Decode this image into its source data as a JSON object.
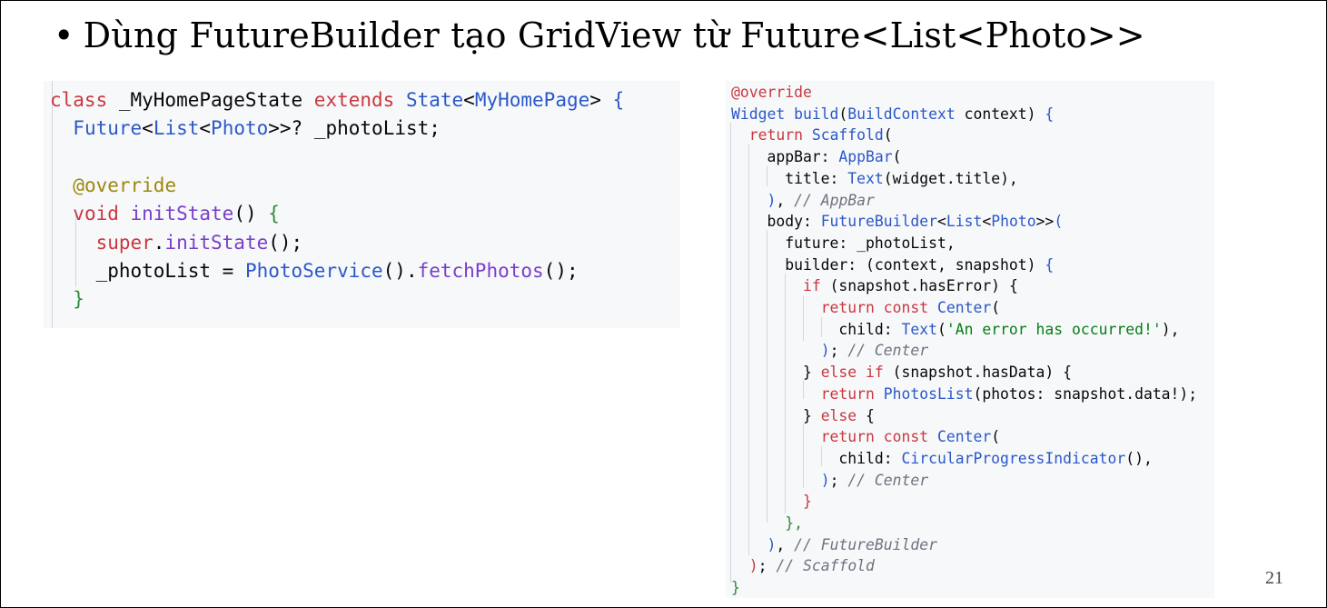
{
  "slide": {
    "bullet": "•",
    "title": "Dùng FutureBuilder tạo GridView từ Future<List<Photo>>",
    "page_number": "21"
  },
  "code_left": [
    [
      [
        "kw",
        "class "
      ],
      [
        "",
        "_MyHomePageState "
      ],
      [
        "kw",
        "extends "
      ],
      [
        "ty",
        "State"
      ],
      [
        "",
        "<"
      ],
      [
        "ty",
        "MyHomePage"
      ],
      [
        "",
        "> "
      ],
      [
        "pb",
        "{"
      ]
    ],
    [
      [
        "",
        "  "
      ],
      [
        "ty",
        "Future"
      ],
      [
        "",
        "<"
      ],
      [
        "ty",
        "List"
      ],
      [
        "",
        "<"
      ],
      [
        "ty",
        "Photo"
      ],
      [
        "",
        ">>? _photoList;"
      ]
    ],
    [],
    [
      [
        "",
        "  "
      ],
      [
        "an",
        "@override"
      ]
    ],
    [
      [
        "",
        "  "
      ],
      [
        "kw",
        "void "
      ],
      [
        "fn",
        "initState"
      ],
      [
        "",
        "() "
      ],
      [
        "pg",
        "{"
      ]
    ],
    [
      [
        "",
        "    "
      ],
      [
        "kw",
        "super"
      ],
      [
        "",
        "."
      ],
      [
        "fn",
        "initState"
      ],
      [
        "",
        "();"
      ]
    ],
    [
      [
        "",
        "    _photoList = "
      ],
      [
        "ty",
        "PhotoService"
      ],
      [
        "",
        "()."
      ],
      [
        "fn",
        "fetchPhotos"
      ],
      [
        "",
        "();"
      ]
    ],
    [
      [
        "",
        "  "
      ],
      [
        "pg",
        "}"
      ]
    ]
  ],
  "code_right": [
    [
      [
        "kw",
        "@override"
      ]
    ],
    [
      [
        "ty",
        "Widget "
      ],
      [
        "ty",
        "build"
      ],
      [
        "",
        "("
      ],
      [
        "ty",
        "BuildContext"
      ],
      [
        "",
        " context) "
      ],
      [
        "pb",
        "{"
      ]
    ],
    [
      [
        "",
        "  "
      ],
      [
        "kw",
        "return "
      ],
      [
        "ty",
        "Scaffold"
      ],
      [
        "",
        "("
      ]
    ],
    [
      [
        "",
        "    appBar: "
      ],
      [
        "ty",
        "AppBar"
      ],
      [
        "",
        "("
      ]
    ],
    [
      [
        "",
        "      title: "
      ],
      [
        "ty",
        "Text"
      ],
      [
        "",
        "(widget.title),"
      ]
    ],
    [
      [
        "",
        "    "
      ],
      [
        "pb",
        ")"
      ],
      [
        "",
        ", "
      ],
      [
        "cm",
        "// AppBar"
      ]
    ],
    [
      [
        "",
        "    body: "
      ],
      [
        "ty",
        "FutureBuilder"
      ],
      [
        "",
        "<"
      ],
      [
        "ty",
        "List"
      ],
      [
        "",
        "<"
      ],
      [
        "ty",
        "Photo"
      ],
      [
        "",
        ">>"
      ],
      [
        "pb",
        "("
      ]
    ],
    [
      [
        "",
        "      future: _photoList,"
      ]
    ],
    [
      [
        "",
        "      builder: (context, snapshot) "
      ],
      [
        "pb",
        "{"
      ]
    ],
    [
      [
        "",
        "        "
      ],
      [
        "kw",
        "if "
      ],
      [
        "",
        "(snapshot.hasError) "
      ],
      [
        "",
        "{"
      ]
    ],
    [
      [
        "",
        "          "
      ],
      [
        "kw",
        "return const "
      ],
      [
        "ty",
        "Center"
      ],
      [
        "",
        "("
      ]
    ],
    [
      [
        "",
        "            child: "
      ],
      [
        "ty",
        "Text"
      ],
      [
        "",
        "("
      ],
      [
        "st",
        "'An error has occurred!'"
      ],
      [
        "",
        "),"
      ]
    ],
    [
      [
        "",
        "          "
      ],
      [
        "pb",
        ")"
      ],
      [
        "",
        "; "
      ],
      [
        "cm",
        "// Center"
      ]
    ],
    [
      [
        "",
        "        } "
      ],
      [
        "kw",
        "else if "
      ],
      [
        "",
        "(snapshot.hasData) {"
      ]
    ],
    [
      [
        "",
        "          "
      ],
      [
        "kw",
        "return "
      ],
      [
        "ty",
        "PhotosList"
      ],
      [
        "",
        "(photos: snapshot.data!);"
      ]
    ],
    [
      [
        "",
        "        } "
      ],
      [
        "kw",
        "else "
      ],
      [
        "",
        "{"
      ]
    ],
    [
      [
        "",
        "          "
      ],
      [
        "kw",
        "return const "
      ],
      [
        "ty",
        "Center"
      ],
      [
        "",
        "("
      ]
    ],
    [
      [
        "",
        "            child: "
      ],
      [
        "ty",
        "CircularProgressIndicator"
      ],
      [
        "",
        "(),"
      ]
    ],
    [
      [
        "",
        "          "
      ],
      [
        "pb",
        ")"
      ],
      [
        "",
        "; "
      ],
      [
        "cm",
        "// Center"
      ]
    ],
    [
      [
        "",
        "        "
      ],
      [
        "kw",
        "}"
      ]
    ],
    [
      [
        "",
        "      "
      ],
      [
        "pg",
        "},"
      ]
    ],
    [
      [
        "",
        "    "
      ],
      [
        "pb",
        ")"
      ],
      [
        "",
        ", "
      ],
      [
        "cm",
        "// FutureBuilder"
      ]
    ],
    [
      [
        "",
        "  "
      ],
      [
        "kw",
        ")"
      ],
      [
        "",
        "; "
      ],
      [
        "cm",
        "// Scaffold"
      ]
    ],
    [
      [
        "pg",
        "}"
      ]
    ]
  ]
}
